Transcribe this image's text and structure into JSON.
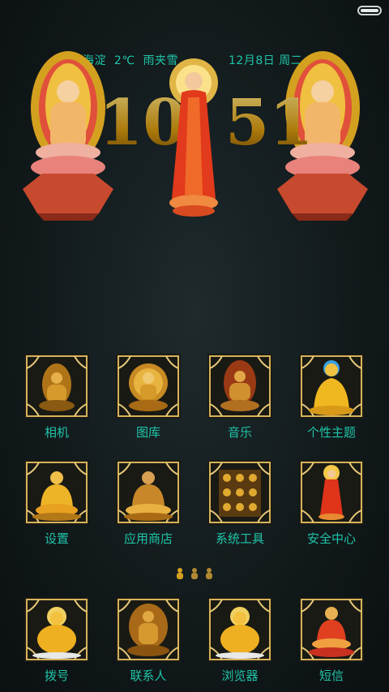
{
  "status_bar": {
    "battery_icon": "battery-icon"
  },
  "weather_widget": {
    "location": "海淀",
    "temperature": "2℃",
    "condition": "雨夹雪"
  },
  "date_widget": {
    "date": "12月8日",
    "weekday": "周二"
  },
  "clock": {
    "hour": "10",
    "minute": "51"
  },
  "page_indicator": {
    "pages": 3,
    "current": 1
  },
  "apps_row1": [
    {
      "label": "相机",
      "icon": "seated-buddha-icon"
    },
    {
      "label": "图库",
      "icon": "thousand-arm-buddha-icon"
    },
    {
      "label": "音乐",
      "icon": "meditating-buddha-icon"
    },
    {
      "label": "个性主题",
      "icon": "golden-buddha-icon"
    }
  ],
  "apps_row2": [
    {
      "label": "设置",
      "icon": "lotus-buddha-icon"
    },
    {
      "label": "应用商店",
      "icon": "bronze-buddha-icon"
    },
    {
      "label": "系统工具",
      "icon": "shrine-icon"
    },
    {
      "label": "安全中心",
      "icon": "standing-buddha-icon"
    }
  ],
  "dock": [
    {
      "label": "拨号",
      "icon": "laughing-buddha-icon"
    },
    {
      "label": "联系人",
      "icon": "many-arm-buddha-icon"
    },
    {
      "label": "浏览器",
      "icon": "laughing-buddha-icon"
    },
    {
      "label": "短信",
      "icon": "red-robe-buddha-icon"
    }
  ]
}
